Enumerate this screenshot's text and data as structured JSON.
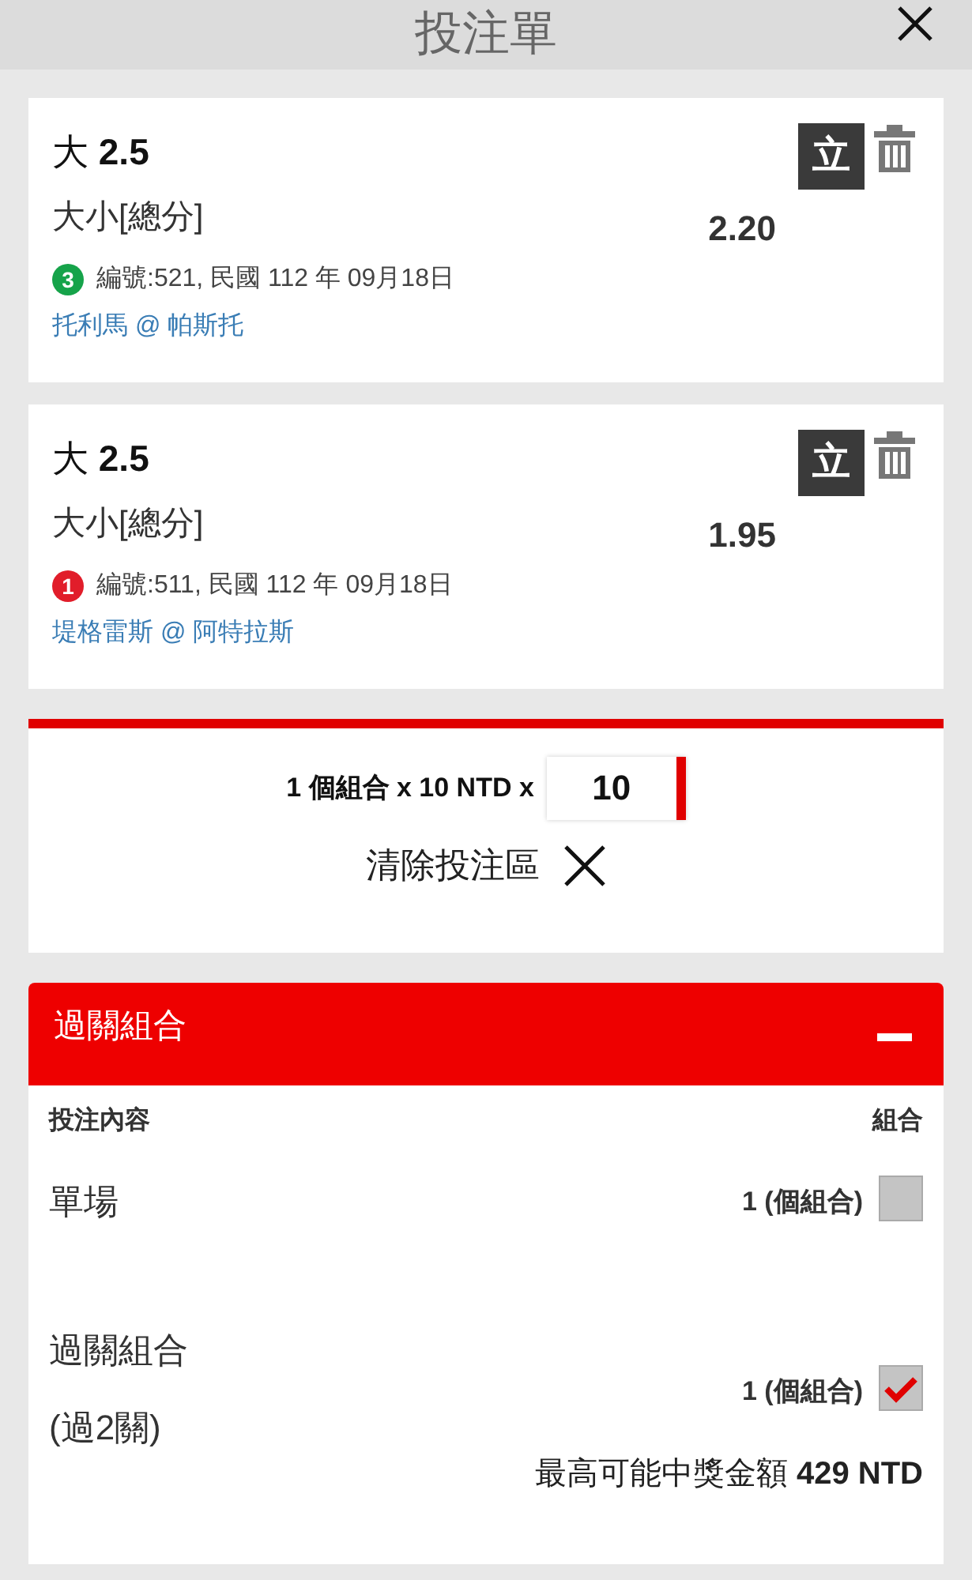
{
  "header": {
    "title": "投注單"
  },
  "bets": [
    {
      "selection": "大",
      "line": "2.5",
      "market": "大小[總分]",
      "odds": "2.20",
      "badge": "3",
      "color": "#16a34a",
      "info": "編號:521, 民國 112 年 09月18日",
      "match": "托利馬 @ 帕斯托",
      "tag": "立"
    },
    {
      "selection": "大",
      "line": "2.5",
      "market": "大小[總分]",
      "odds": "1.95",
      "badge": "1",
      "color": "#e11d2a",
      "info": "編號:511, 民國 112 年 09月18日",
      "match": "堤格雷斯 @ 阿特拉斯",
      "tag": "立"
    }
  ],
  "stake": {
    "label": "1 個組合 x 10 NTD x",
    "value": "10",
    "clear": "清除投注區"
  },
  "parlay": {
    "title": "過關組合",
    "expanded": true,
    "col_left": "投注內容",
    "col_right": "組合",
    "rows": [
      {
        "label": "單場",
        "sub": "",
        "count": "1 (個組合)",
        "checked": false
      },
      {
        "label": "過關組合",
        "sub": "(過2關)",
        "count": "1 (個組合)",
        "checked": true
      }
    ],
    "max_label": "最高可能中獎金額",
    "max_value": "429 NTD"
  }
}
